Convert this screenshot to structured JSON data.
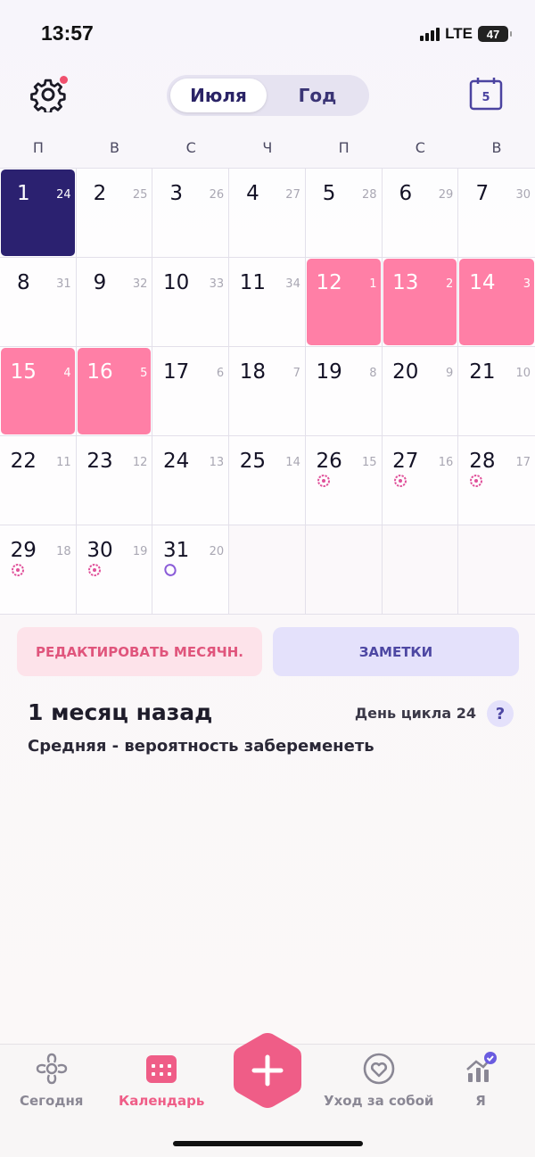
{
  "status_bar": {
    "time": "13:57",
    "network": "LTE",
    "battery": "47"
  },
  "header": {
    "segment": {
      "active": "Июля",
      "inactive": "Год"
    },
    "calendar_today_number": "5",
    "icons": {
      "settings": "gear-icon",
      "calendar": "calendar-icon"
    }
  },
  "weekdays": [
    "П",
    "В",
    "С",
    "Ч",
    "П",
    "С",
    "В"
  ],
  "calendar": {
    "month": "Июля",
    "days": [
      {
        "day": "1",
        "cycle": "24",
        "state": "today"
      },
      {
        "day": "2",
        "cycle": "25"
      },
      {
        "day": "3",
        "cycle": "26"
      },
      {
        "day": "4",
        "cycle": "27"
      },
      {
        "day": "5",
        "cycle": "28"
      },
      {
        "day": "6",
        "cycle": "29"
      },
      {
        "day": "7",
        "cycle": "30"
      },
      {
        "day": "8",
        "cycle": "31"
      },
      {
        "day": "9",
        "cycle": "32"
      },
      {
        "day": "10",
        "cycle": "33"
      },
      {
        "day": "11",
        "cycle": "34"
      },
      {
        "day": "12",
        "cycle": "1",
        "state": "period"
      },
      {
        "day": "13",
        "cycle": "2",
        "state": "period"
      },
      {
        "day": "14",
        "cycle": "3",
        "state": "period"
      },
      {
        "day": "15",
        "cycle": "4",
        "state": "period"
      },
      {
        "day": "16",
        "cycle": "5",
        "state": "period"
      },
      {
        "day": "17",
        "cycle": "6"
      },
      {
        "day": "18",
        "cycle": "7"
      },
      {
        "day": "19",
        "cycle": "8"
      },
      {
        "day": "20",
        "cycle": "9"
      },
      {
        "day": "21",
        "cycle": "10"
      },
      {
        "day": "22",
        "cycle": "11"
      },
      {
        "day": "23",
        "cycle": "12"
      },
      {
        "day": "24",
        "cycle": "13"
      },
      {
        "day": "25",
        "cycle": "14"
      },
      {
        "day": "26",
        "cycle": "15",
        "marker": "fertile"
      },
      {
        "day": "27",
        "cycle": "16",
        "marker": "fertile"
      },
      {
        "day": "28",
        "cycle": "17",
        "marker": "fertile"
      },
      {
        "day": "29",
        "cycle": "18",
        "marker": "fertile"
      },
      {
        "day": "30",
        "cycle": "19",
        "marker": "fertile"
      },
      {
        "day": "31",
        "cycle": "20",
        "marker": "ovulation"
      },
      {
        "day": "",
        "cycle": "",
        "state": "empty"
      },
      {
        "day": "",
        "cycle": "",
        "state": "empty"
      },
      {
        "day": "",
        "cycle": "",
        "state": "empty"
      },
      {
        "day": "",
        "cycle": "",
        "state": "empty"
      }
    ],
    "colors": {
      "period": "#ff7fa6",
      "today": "#2b2170",
      "fertile": "#e0509a",
      "ovulation": "#8a5bd8"
    }
  },
  "actions": {
    "edit_label": "РЕДАКТИРОВАТЬ МЕСЯЧН.",
    "notes_label": "ЗАМЕТКИ"
  },
  "info": {
    "when": "1 месяц назад",
    "cycle_day": "День цикла 24",
    "help": "?",
    "pregnancy_chance": "Средняя - вероятность забеременеть"
  },
  "tabbar": {
    "items": [
      {
        "label": "Сегодня",
        "icon": "flower-icon"
      },
      {
        "label": "Календарь",
        "icon": "calendar-grid-icon",
        "active": true
      },
      {
        "label": "Уход за собой",
        "icon": "heart-circle-icon"
      },
      {
        "label": "Я",
        "icon": "stats-check-icon"
      }
    ],
    "add_icon": "plus-icon",
    "accent": "#ef5d87"
  }
}
